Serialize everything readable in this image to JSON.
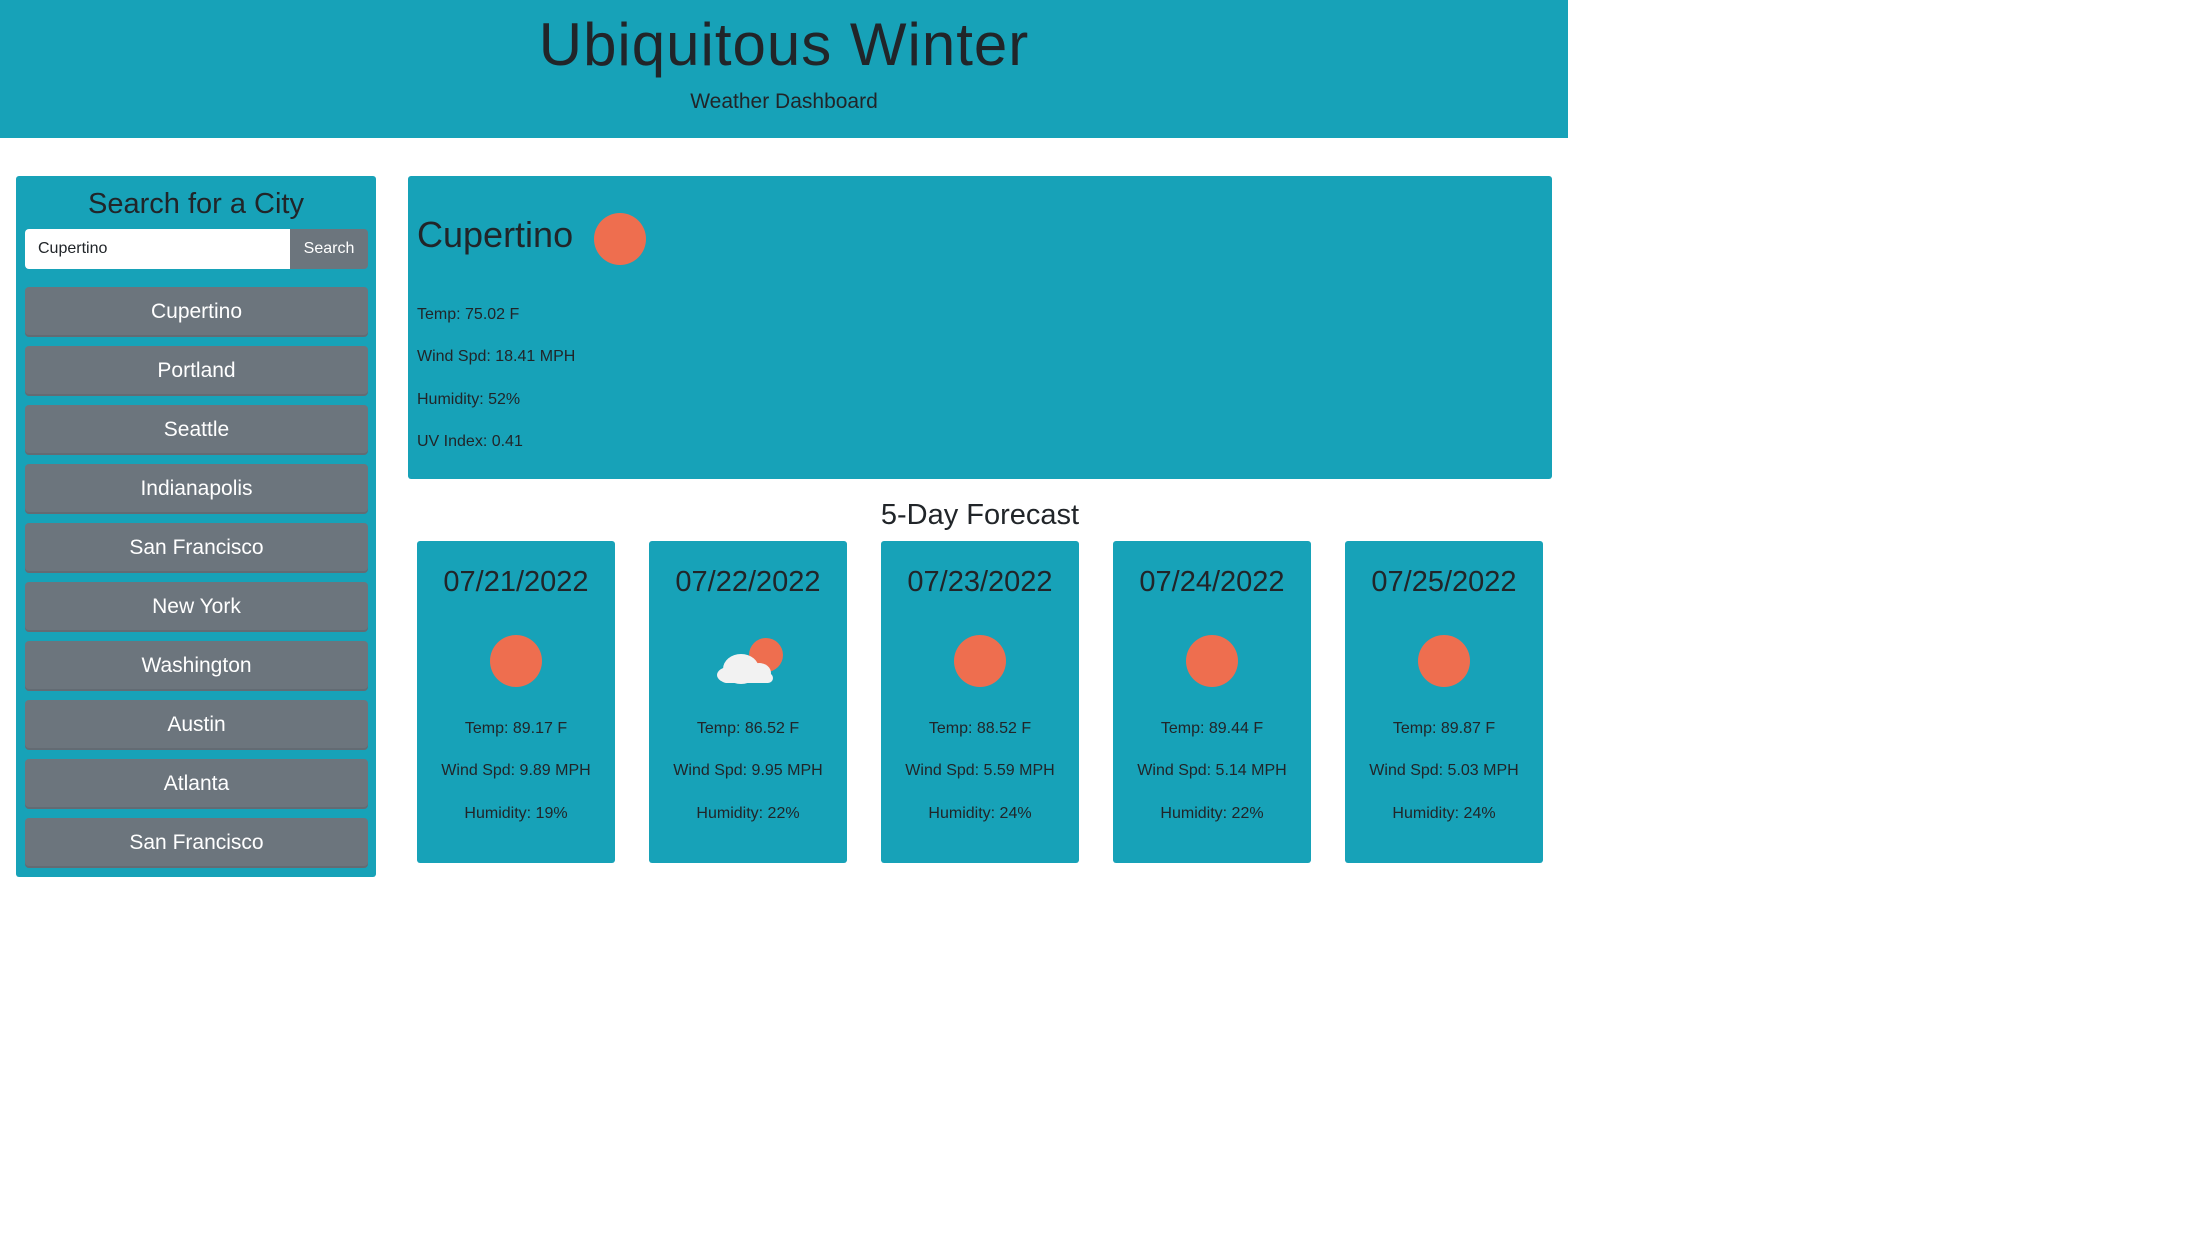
{
  "header": {
    "title": "Ubiquitous Winter",
    "subtitle": "Weather Dashboard"
  },
  "sidebar": {
    "title": "Search for a City",
    "search": {
      "value": "Cupertino",
      "button_label": "Search"
    },
    "cities": [
      "Cupertino",
      "Portland",
      "Seattle",
      "Indianapolis",
      "San Francisco",
      "New York",
      "Washington",
      "Austin",
      "Atlanta",
      "San Francisco"
    ]
  },
  "current": {
    "city": "Cupertino",
    "icon": "sun-icon",
    "temp": "Temp: 75.02 F",
    "wind": "Wind Spd: 18.41 MPH",
    "humidity": "Humidity: 52%",
    "uv": "UV Index: 0.41"
  },
  "forecast": {
    "title": "5-Day Forecast",
    "days": [
      {
        "date": "07/21/2022",
        "icon": "sun-icon",
        "temp": "Temp: 89.17 F",
        "wind": "Wind Spd: 9.89 MPH",
        "humidity": "Humidity: 19%"
      },
      {
        "date": "07/22/2022",
        "icon": "cloud-sun-icon",
        "temp": "Temp: 86.52 F",
        "wind": "Wind Spd: 9.95 MPH",
        "humidity": "Humidity: 22%"
      },
      {
        "date": "07/23/2022",
        "icon": "sun-icon",
        "temp": "Temp: 88.52 F",
        "wind": "Wind Spd: 5.59 MPH",
        "humidity": "Humidity: 24%"
      },
      {
        "date": "07/24/2022",
        "icon": "sun-icon",
        "temp": "Temp: 89.44 F",
        "wind": "Wind Spd: 5.14 MPH",
        "humidity": "Humidity: 22%"
      },
      {
        "date": "07/25/2022",
        "icon": "sun-icon",
        "temp": "Temp: 89.87 F",
        "wind": "Wind Spd: 5.03 MPH",
        "humidity": "Humidity: 24%"
      }
    ]
  },
  "colors": {
    "accent": "#17a2b8",
    "button": "#6c757d",
    "sun": "#ee6e4f"
  }
}
